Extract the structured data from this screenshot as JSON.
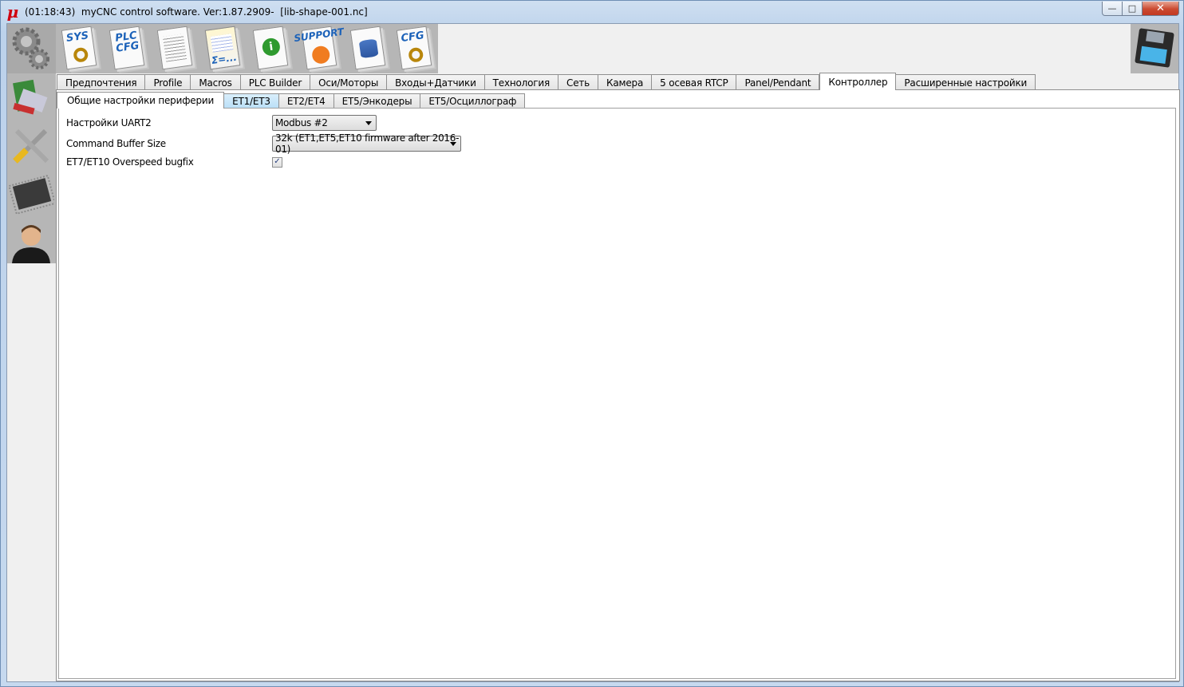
{
  "window": {
    "app_glyph": "μ",
    "title": "(01:18:43)  myCNC control software. Ver:1.87.2909-  [lib-shape-001.nc]",
    "controls": {
      "minimize": "—",
      "maximize": "□",
      "close": "✕"
    }
  },
  "toolbar": {
    "items": [
      {
        "label": "SYS",
        "icon": "sys-gear-icon"
      },
      {
        "label": "PLC CFG",
        "icon": "plc-cfg-icon"
      },
      {
        "label": "",
        "icon": "table-document-icon"
      },
      {
        "label": "Σ=...",
        "icon": "formula-document-icon"
      },
      {
        "label": "i",
        "icon": "info-icon"
      },
      {
        "label": "SUPPORT",
        "icon": "support-phone-icon"
      },
      {
        "label": "",
        "icon": "database-icon"
      },
      {
        "label": "CFG",
        "icon": "cfg-gear-icon"
      }
    ],
    "save_icon": "floppy-save-icon"
  },
  "sidebar": {
    "items": [
      {
        "icon": "gears-icon"
      },
      {
        "icon": "book-icon"
      },
      {
        "icon": "tools-icon"
      },
      {
        "icon": "chip-icon"
      },
      {
        "icon": "user-icon"
      }
    ]
  },
  "main_tabs": [
    "Предпочтения",
    "Profile",
    "Macros",
    "PLC Builder",
    "Оси/Моторы",
    "Входы+Датчики",
    "Технология",
    "Сеть",
    "Камера",
    "5 осевая RTCP",
    "Panel/Pendant",
    "Контроллер",
    "Расширенные настройки"
  ],
  "main_tab_active": "Контроллер",
  "sub_tabs": [
    "Общие настройки периферии",
    "ET1/ET3",
    "ET2/ET4",
    "ET5/Энкодеры",
    "ET5/Осциллограф"
  ],
  "sub_tab_active": "Общие настройки периферии",
  "settings": {
    "uart2": {
      "label": "Настройки UART2",
      "value": "Modbus #2"
    },
    "buffer": {
      "label": "Command Buffer Size",
      "value": "32k (ET1,ET5,ET10 firmware after 2016-01)"
    },
    "overspeed": {
      "label": "ET7/ET10 Overspeed bugfix",
      "checked": true,
      "mark": "✓"
    }
  },
  "colors": {
    "close_button": "#c8432b",
    "highlight_tab": "#b9dff7",
    "app_glyph": "#d0000f"
  }
}
